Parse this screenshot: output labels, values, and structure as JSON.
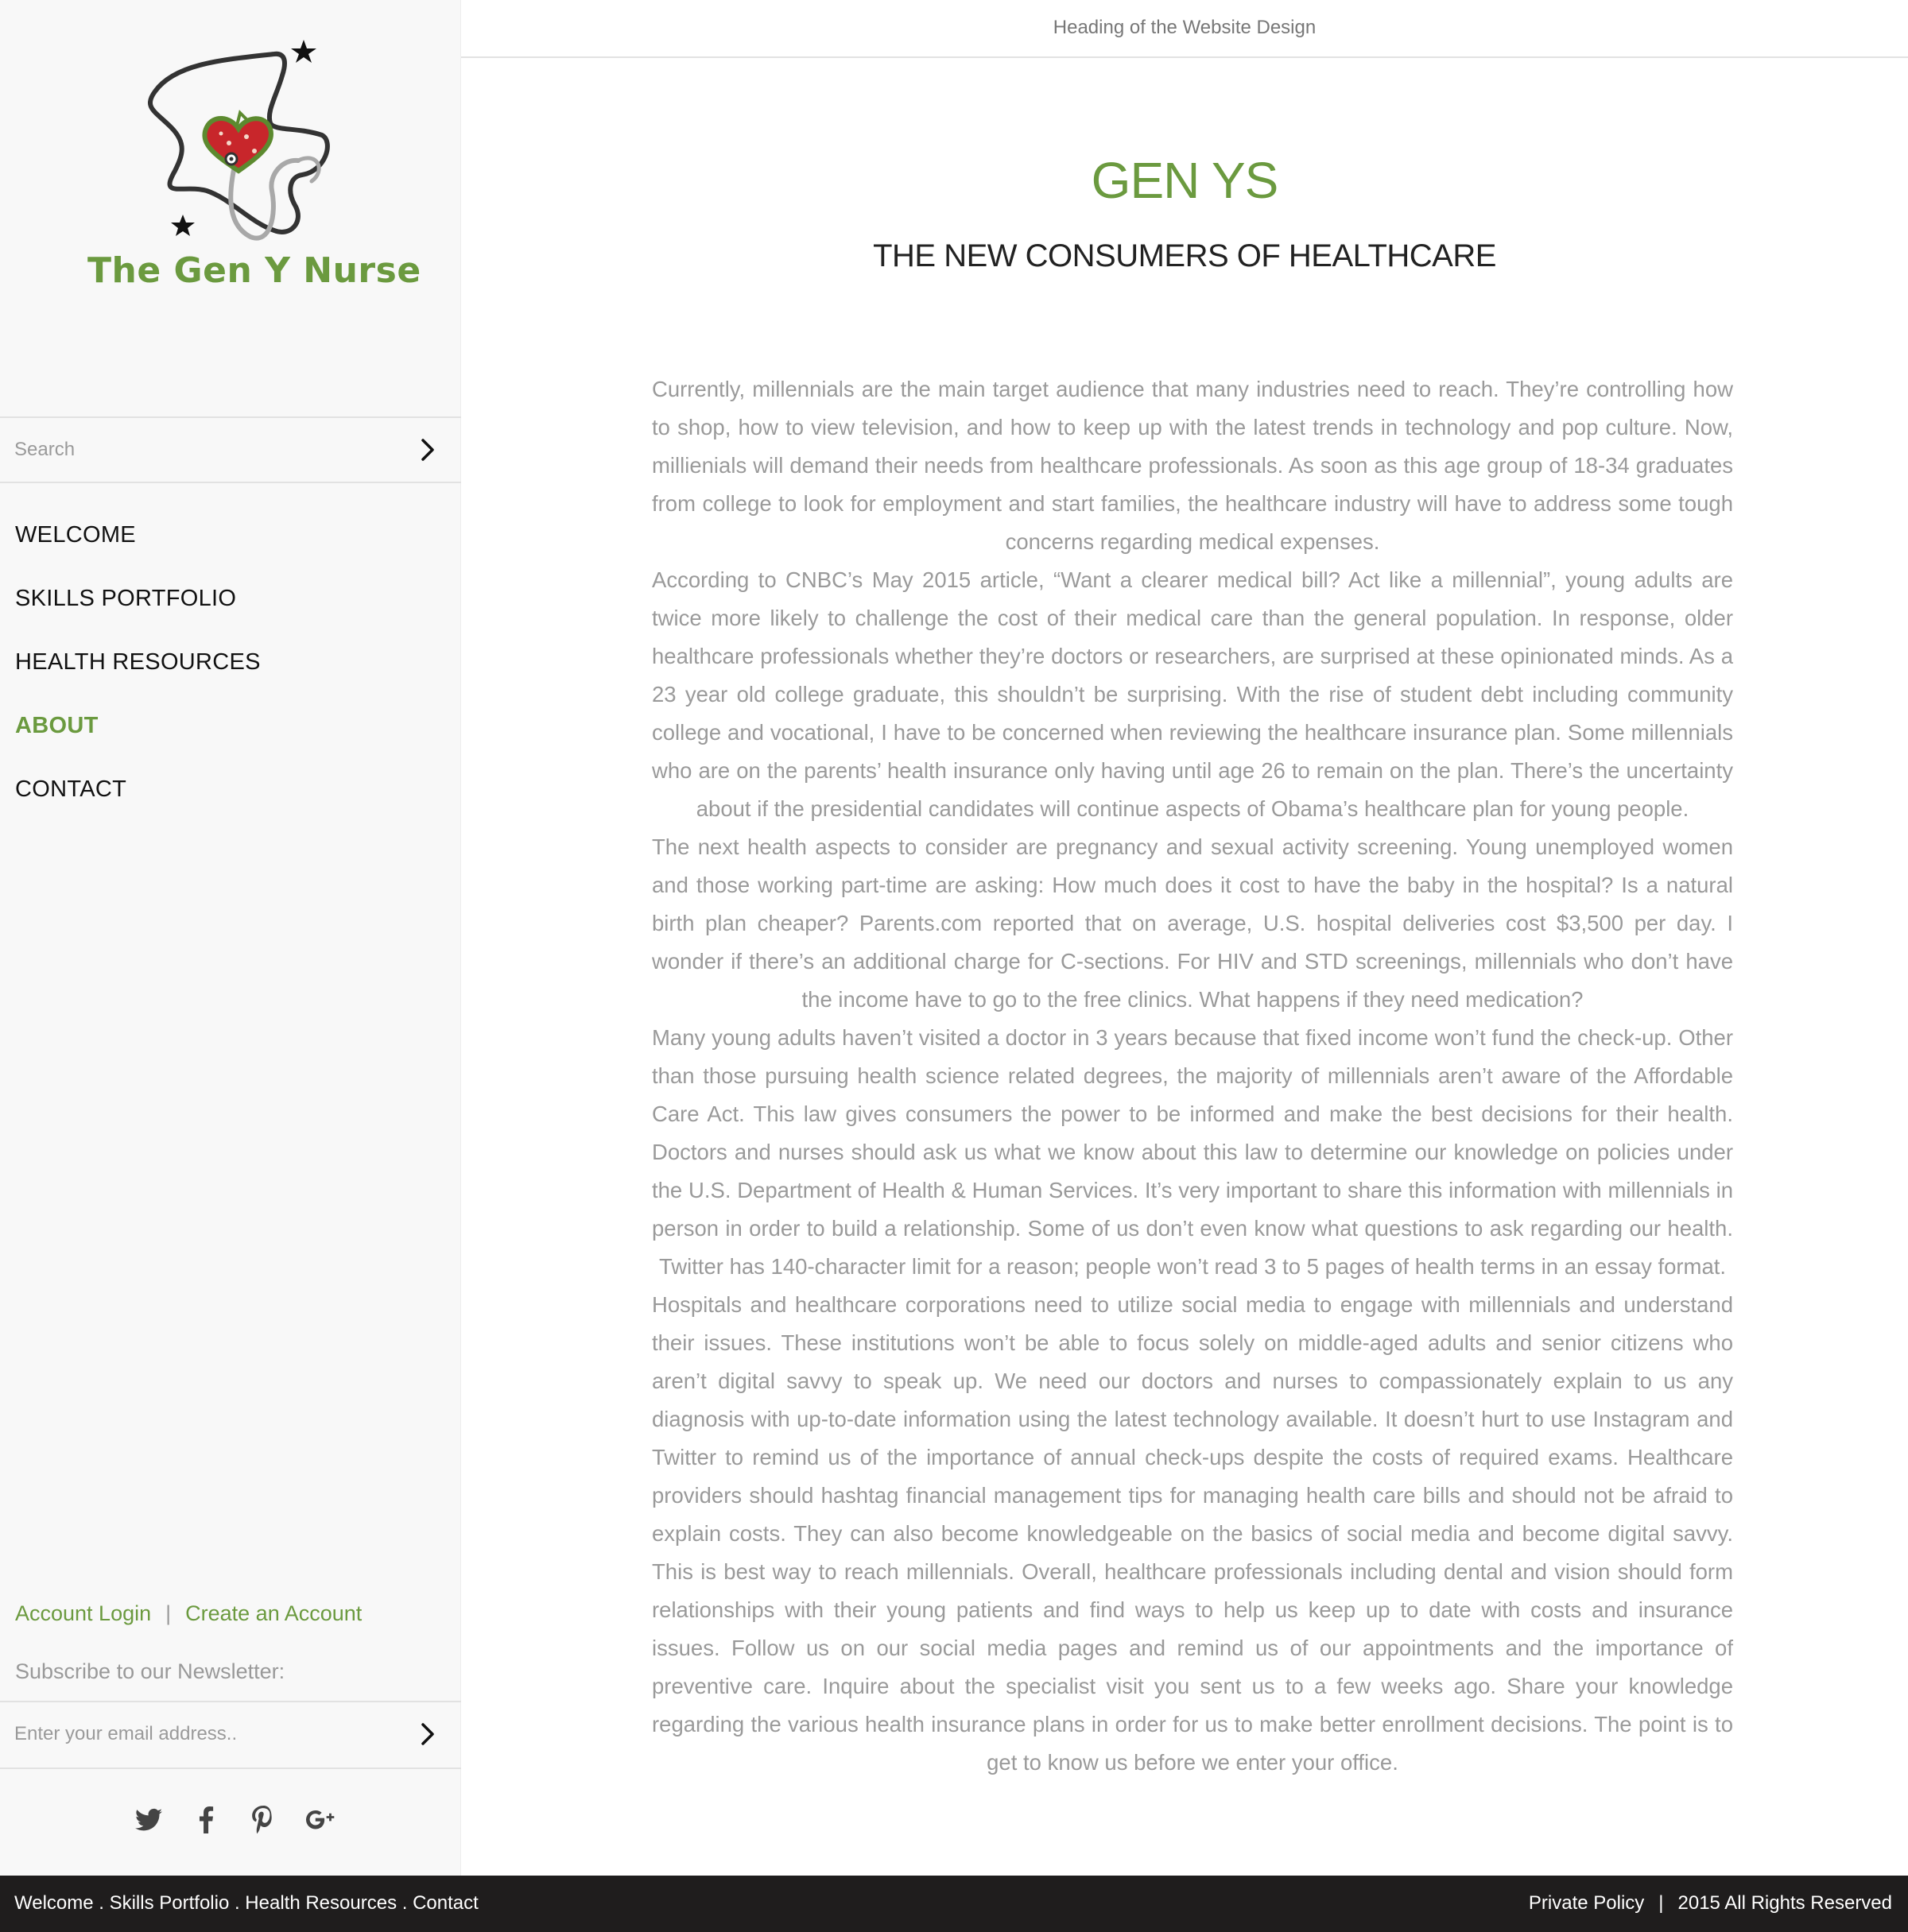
{
  "brand": {
    "name": "The Gen Y Nurse",
    "logo_icon": "nurse-cap-heart-stethoscope-logo"
  },
  "search": {
    "placeholder": "Search"
  },
  "nav": {
    "items": [
      {
        "label": "WELCOME",
        "active": false
      },
      {
        "label": "SKILLS PORTFOLIO",
        "active": false
      },
      {
        "label": "HEALTH RESOURCES",
        "active": false
      },
      {
        "label": "ABOUT",
        "active": true
      },
      {
        "label": "CONTACT",
        "active": false
      }
    ]
  },
  "account": {
    "login": "Account Login",
    "separator": "|",
    "create": "Create an Account"
  },
  "newsletter": {
    "label": "Subscribe to our Newsletter:",
    "placeholder": "Enter your email address.."
  },
  "social": [
    "twitter-icon",
    "facebook-icon",
    "pinterest-icon",
    "google-plus-icon"
  ],
  "header": {
    "site_heading": "Heading of the Website Design"
  },
  "main": {
    "title": "GEN YS",
    "subtitle": "THE NEW CONSUMERS OF HEALTHCARE",
    "paragraphs": [
      "Currently, millennials are the main target audience that many industries need to reach. They’re controlling how to shop, how to view television, and how to keep up with the latest trends in technology and pop culture. Now, millienials will demand their needs from healthcare professionals. As soon as this age group of 18-34 graduates from college to look for employment and start families, the healthcare industry will have to address some tough concerns regarding medical expenses.",
      "According to CNBC’s May 2015 article, “Want a clearer medical bill? Act like a millennial”, young adults are twice more likely to challenge the cost of their medical care than the general population. In response, older healthcare professionals whether they’re doctors or researchers, are surprised at these opinionated minds. As a 23 year old college graduate, this shouldn’t be surprising. With the rise of student debt including community college and vocational, I have to be concerned when reviewing the healthcare insurance plan. Some millennials who are on the parents’ health insurance only having until age 26 to remain on the plan. There’s the uncertainty about if the presidential candidates will continue aspects of Obama’s healthcare plan for young people.",
      "The next health aspects to consider are pregnancy and sexual activity screening. Young unemployed women and those working part-time are asking: How much does it cost to have the baby in the hospital? Is a natural birth plan cheaper? Parents.com reported that on average, U.S. hospital deliveries cost $3,500 per day. I wonder if there’s an additional charge for C-sections. For HIV and STD screenings, millennials who don’t have the income have to go to the free clinics. What happens if they need medication?",
      "Many young adults haven’t visited a doctor in 3 years because that fixed income won’t fund the check-up. Other than those pursuing health science related degrees, the majority of millennials aren’t aware of the Affordable Care Act. This law gives consumers the power to be informed and make the best decisions for their health. Doctors and nurses should ask us what we know about this law to determine our knowledge on policies under the U.S. Department of Health & Human Services.  It’s very important to share this information with millennials in person in order to build a relationship. Some of us don’t even know what questions to ask regarding our health. Twitter has 140-character limit for a reason; people won’t read 3 to 5 pages of health terms in an essay format.",
      "Hospitals and healthcare corporations need to utilize social media to engage with millennials and understand their issues. These institutions won’t be able to focus solely on middle-aged adults and senior citizens who aren’t digital savvy to speak up.  We need our doctors and nurses to compassionately explain to us any diagnosis with up-to-date information using the latest technology available. It doesn’t hurt to use Instagram and Twitter to remind us of the importance of annual check-ups despite the costs of required exams. Healthcare providers should hashtag financial management tips for managing health care bills and should not be afraid to explain costs. They can also become knowledgeable on the basics of social media and become digital savvy. This is best way to reach millennials. Overall, healthcare professionals including dental and vision should form relationships with their young patients and find ways to help us keep up to date with costs and insurance issues. Follow us on our social media pages and remind us of our appointments and the importance of preventive care. Inquire about the specialist visit you sent us to a few weeks ago. Share your knowledge regarding the various health insurance plans in order for us to make better enrollment decisions. The point is to get to know us before we enter your office."
    ]
  },
  "footer": {
    "links": "Welcome . Skills Portfolio . Health Resources . Contact",
    "privacy": "Private Policy",
    "separator": "|",
    "rights": "2015 All Rights Reserved"
  },
  "colors": {
    "accent": "#6b9a3f",
    "footer_bg": "#1f1d1d",
    "body_text": "#9a9a9a",
    "sidebar_bg": "#f8f8f8"
  }
}
